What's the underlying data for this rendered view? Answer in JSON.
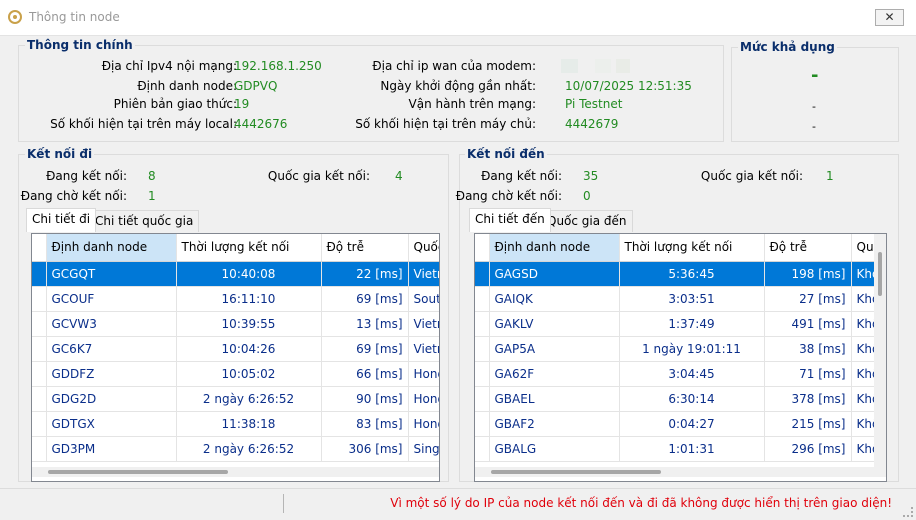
{
  "window": {
    "title": "Thông tin node",
    "close_label": "✕"
  },
  "main_info": {
    "title": "Thông tin chính",
    "ipv4_label": "Địa chỉ Ipv4 nội mạng:",
    "ipv4_value": "192.168.1.250",
    "node_id_label": "Định danh node:",
    "node_id_value": "GDPVQ",
    "protocol_label": "Phiên bản giao thức:",
    "protocol_value": "19",
    "local_blocks_label": "Số khối hiện tại trên máy local:",
    "local_blocks_value": "4442676",
    "wan_ip_label": "Địa chỉ ip wan của modem:",
    "boot_label": "Ngày khởi động gần nhất:",
    "boot_value": "10/07/2025 12:51:35",
    "network_label": "Vận hành trên mạng:",
    "network_value": "Pi Testnet",
    "server_blocks_label": "Số khối hiện tại trên máy chủ:",
    "server_blocks_value": "4442679"
  },
  "availability": {
    "title": "Mức khả dụng",
    "main": "-",
    "line1": "-",
    "line2": "-"
  },
  "outgoing": {
    "title": "Kết nối đi",
    "connecting_label": "Đang kết nối:",
    "connecting_value": "8",
    "country_label": "Quốc gia kết nối:",
    "country_value": "4",
    "waiting_label": "Đang chờ kết nối:",
    "waiting_value": "1",
    "tabs": [
      "Chi tiết đi",
      "Chi tiết quốc gia"
    ],
    "columns": [
      "Định danh node",
      "Thời lượng kết nối",
      "Độ trễ",
      "Quốc"
    ],
    "rows": [
      [
        "GCGQT",
        "10:40:08",
        "22 [ms]",
        "Vietna"
      ],
      [
        "GCOUF",
        "16:11:10",
        "69 [ms]",
        "South"
      ],
      [
        "GCVW3",
        "10:39:55",
        "13 [ms]",
        "Vietna"
      ],
      [
        "GC6K7",
        "10:04:26",
        "69 [ms]",
        "Vietna"
      ],
      [
        "GDDFZ",
        "10:05:02",
        "66 [ms]",
        "Hong"
      ],
      [
        "GDG2D",
        "2 ngày 6:26:52",
        "90 [ms]",
        "Hong"
      ],
      [
        "GDTGX",
        "11:38:18",
        "83 [ms]",
        "Hong"
      ],
      [
        "GD3PM",
        "2 ngày 6:26:52",
        "306 [ms]",
        "Singa"
      ]
    ]
  },
  "incoming": {
    "title": "Kết nối đến",
    "connecting_label": "Đang kết nối:",
    "connecting_value": "35",
    "country_label": "Quốc gia kết nối:",
    "country_value": "1",
    "waiting_label": "Đang chờ kết nối:",
    "waiting_value": "0",
    "tabs": [
      "Chi tiết đến",
      "Quốc gia đến"
    ],
    "columns": [
      "Định danh node",
      "Thời lượng kết nối",
      "Độ trễ",
      "Qu"
    ],
    "rows": [
      [
        "GAGSD",
        "5:36:45",
        "198 [ms]",
        "Khô"
      ],
      [
        "GAIQK",
        "3:03:51",
        "27 [ms]",
        "Khô"
      ],
      [
        "GAKLV",
        "1:37:49",
        "491 [ms]",
        "Khô"
      ],
      [
        "GAP5A",
        "1 ngày 19:01:11",
        "38 [ms]",
        "Khô"
      ],
      [
        "GA62F",
        "3:04:45",
        "71 [ms]",
        "Khô"
      ],
      [
        "GBAEL",
        "6:30:14",
        "378 [ms]",
        "Khô"
      ],
      [
        "GBAF2",
        "0:04:27",
        "215 [ms]",
        "Khô"
      ],
      [
        "GBALG",
        "1:01:31",
        "296 [ms]",
        "Khô"
      ]
    ]
  },
  "status": {
    "message": "Vì một số lý do IP của node kết nối đến và đi đã không được hiển thị trên giao diện!"
  }
}
